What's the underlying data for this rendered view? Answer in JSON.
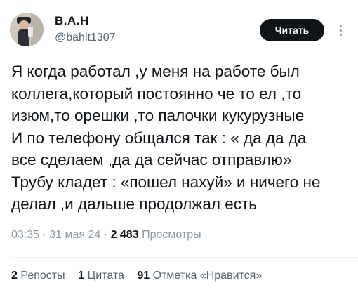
{
  "author": {
    "name": "В.А.Н",
    "handle": "@bahit1307"
  },
  "follow_label": "Читать",
  "tweet_lines": [
    "Я когда работал ,у меня на работе был",
    "коллега,который постоянно че то ел ,то",
    "изюм,то орешки ,то палочки кукурузные",
    "И по телефону общался так : « да да да",
    "все сделаем ,да да сейчас отправлю»",
    "Трубу кладет : «пошел нахуй» и ничего не",
    "делал ,и дальше продолжал есть"
  ],
  "meta": {
    "time": "03:35",
    "sep": "·",
    "date": "31 мая 24",
    "views_count": "2 483",
    "views_label": "Просмотры"
  },
  "stats": {
    "reposts_count": "2",
    "reposts_label": "Репосты",
    "quotes_count": "1",
    "quotes_label": "Цитата",
    "likes_count": "91",
    "likes_label": "Отметка «Нравится»"
  },
  "icons": {
    "more": "more-vertical-icon"
  }
}
